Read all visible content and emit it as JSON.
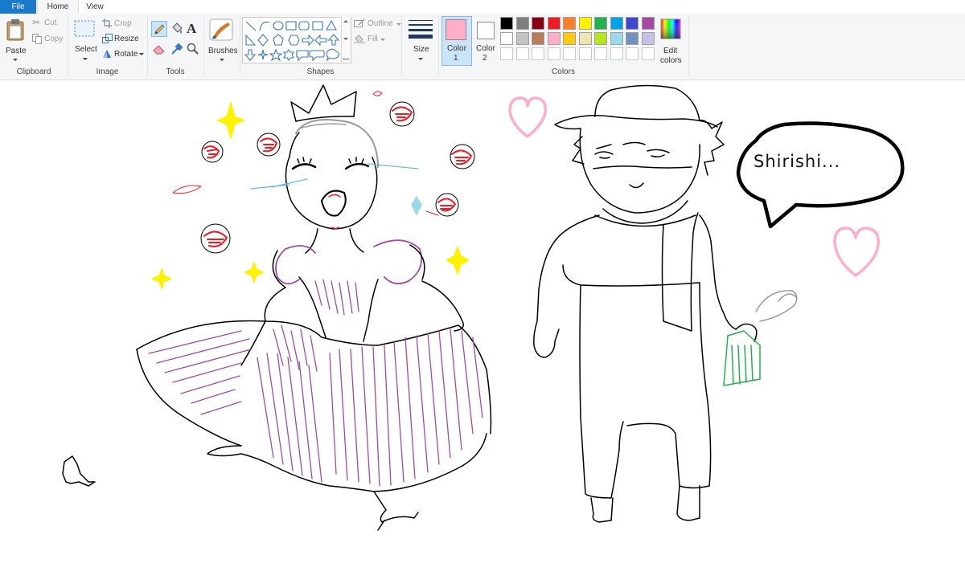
{
  "tabs": {
    "file": "File",
    "home": "Home",
    "view": "View"
  },
  "clipboard": {
    "paste": "Paste",
    "cut": "Cut",
    "copy": "Copy",
    "group": "Clipboard"
  },
  "image": {
    "select": "Select",
    "crop": "Crop",
    "resize": "Resize",
    "rotate": "Rotate",
    "group": "Image"
  },
  "tools": {
    "group": "Tools"
  },
  "brushes": {
    "label": "Brushes"
  },
  "shapes": {
    "outline": "Outline",
    "fill": "Fill",
    "group": "Shapes"
  },
  "size": {
    "label": "Size"
  },
  "colors": {
    "color1_line1": "Color",
    "color1_line2": "1",
    "color2_line1": "Color",
    "color2_line2": "2",
    "edit_line1": "Edit",
    "edit_line2": "colors",
    "group": "Colors",
    "color1_value": "#ffaec9",
    "color2_value": "#ffffff",
    "palette_row1": [
      "#000000",
      "#7f7f7f",
      "#880015",
      "#ed1c24",
      "#ff7f27",
      "#fff200",
      "#22b14c",
      "#00a2e8",
      "#3f48cc",
      "#a349a4"
    ],
    "palette_row2": [
      "#ffffff",
      "#c3c3c3",
      "#b97a57",
      "#ffaec9",
      "#ffc90e",
      "#efe4b0",
      "#b5e61d",
      "#99d9ea",
      "#7092be",
      "#c8bfe7"
    ]
  },
  "canvas": {
    "speech_text": "Shirishi..."
  }
}
